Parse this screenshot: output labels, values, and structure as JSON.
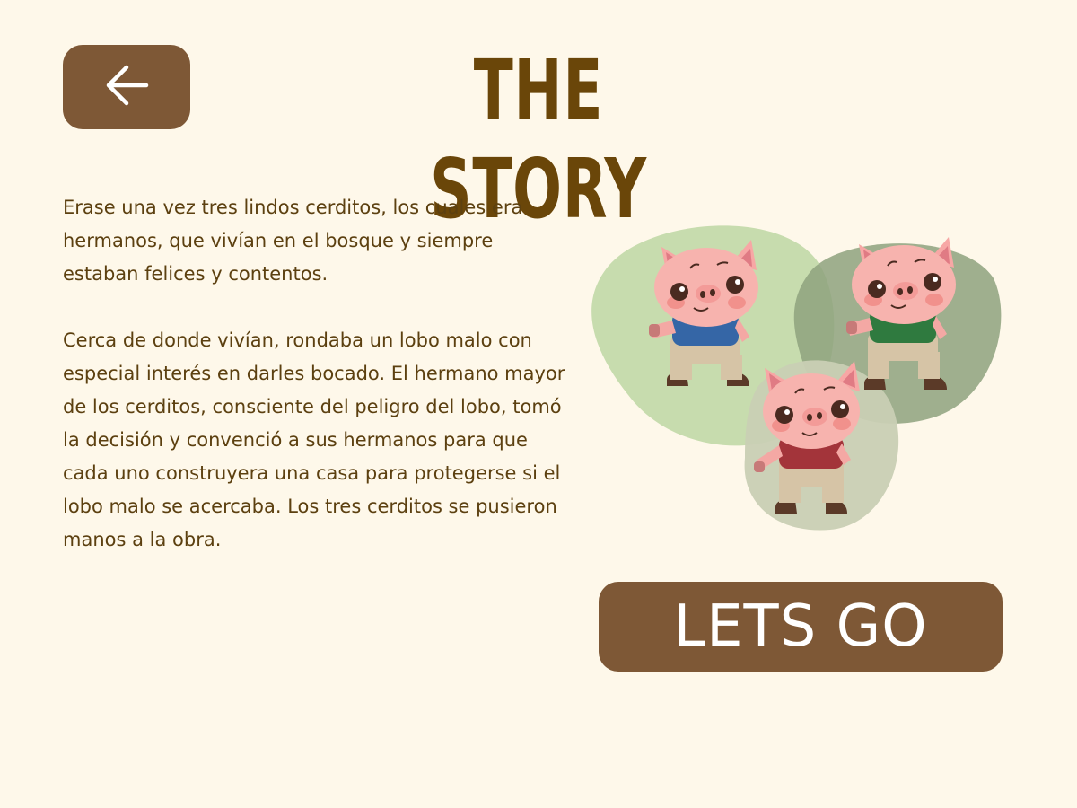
{
  "header": {
    "title": "THE STORY",
    "back_icon": "arrow-left-icon"
  },
  "story": {
    "paragraphs": [
      "Erase una vez tres lindos cerditos, los cuales era hermanos, que vivían en el bosque y siempre estaban felices y contentos.",
      "Cerca de donde vivían, rondaba un lobo malo con especial interés en darles bocado. El hermano mayor de los cerditos, consciente del peligro del lobo, tomó la decisión y convenció a sus hermanos para que cada uno construyera una casa para protegerse si el lobo malo se acercaba. Los tres cerditos se pusieron manos a la obra."
    ]
  },
  "illustration": {
    "pigs": [
      {
        "shirt_color": "#3566a6"
      },
      {
        "shirt_color": "#2f7a3f"
      },
      {
        "shirt_color": "#a3343a"
      }
    ],
    "blob_colors": [
      "#c7dcae",
      "#8ea27e",
      "#c9cfb4"
    ]
  },
  "actions": {
    "go_label": "LETS GO"
  },
  "colors": {
    "background": "#fef8ea",
    "button": "#7e5836",
    "title": "#6a4609",
    "text": "#5c4010"
  }
}
